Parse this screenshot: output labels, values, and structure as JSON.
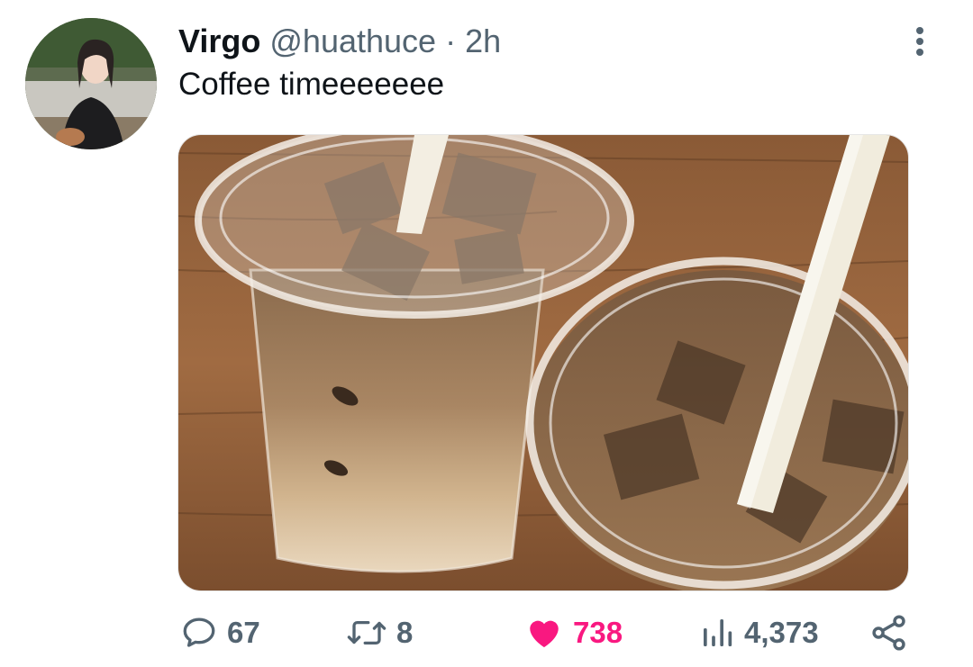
{
  "tweet": {
    "author_name": "Virgo",
    "handle": "@huathuce",
    "separator": "·",
    "time": "2h",
    "text": "Coffee timeeeeeee"
  },
  "media": {
    "type": "photo",
    "subject": "two iced coffees in plastic cups on a wooden table"
  },
  "actions": {
    "replies": "67",
    "retweets": "8",
    "likes": "738",
    "views": "4,373"
  },
  "icons": {
    "reply": "comment-icon",
    "retweet": "retweet-icon",
    "like": "heart-icon",
    "views": "views-chart-icon",
    "share": "share-icon",
    "more": "more-vertical-icon"
  },
  "colors": {
    "text_primary": "#0f1419",
    "text_secondary": "#536471",
    "like_active": "#f91880"
  }
}
